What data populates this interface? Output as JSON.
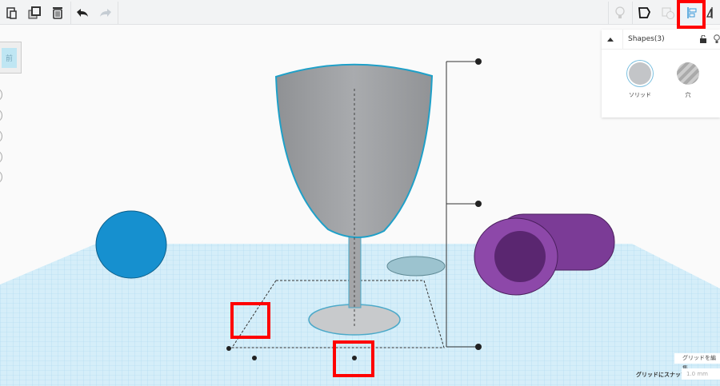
{
  "toolbar": {
    "left": [
      "copy-icon",
      "duplicate-icon",
      "delete-icon",
      "undo-icon",
      "redo-icon"
    ],
    "right": [
      "light-bulb-icon",
      "note-icon",
      "group-icon",
      "align-icon",
      "mirror-icon"
    ]
  },
  "view_cube": {
    "label": "前"
  },
  "shapes_panel": {
    "title": "Shapes(3)",
    "solid_label": "ソリッド",
    "hole_label": "穴"
  },
  "grid": {
    "edit_label": "グリッドを編集",
    "snap_label": "グリッドにスナップ",
    "snap_value": "1.0 mm"
  },
  "colors": {
    "sphere": "#1a8fc9",
    "tube": "#7b3b96",
    "cup": "#a3a5a8",
    "grid": "#d7f0fa",
    "highlight": "#ff0000"
  }
}
